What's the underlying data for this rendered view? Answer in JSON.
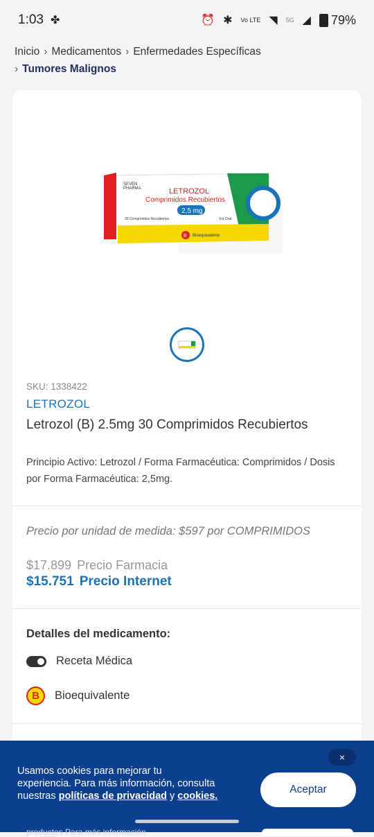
{
  "status_bar": {
    "time": "1:03",
    "battery": "79%",
    "network": "5G",
    "volte": "Vo LTE"
  },
  "breadcrumb": {
    "items": [
      "Inicio",
      "Medicamentos",
      "Enfermedades Específicas"
    ],
    "current": "Tumores Malignos"
  },
  "product": {
    "image_lettering": {
      "brand_logo": "SEVEN PHARMA",
      "name": "LETROZOL",
      "form": "Comprimidos Recubiertos",
      "dose": "2,5 mg",
      "count": "30 Comprimidos Recubiertos",
      "route": "Vía Oral",
      "badge": "Bioequivalente"
    },
    "sku": "SKU: 1338422",
    "brand": "LETROZOL",
    "title": "Letrozol (B) 2.5mg 30 Comprimidos Recubiertos",
    "description": "Principio Activo: Letrozol / Forma Farmacéutica: Comprimidos / Dosis por Forma Farmacéutica: 2,5mg."
  },
  "pricing": {
    "unit_price": "Precio por unidad de medida: $597 por COMPRIMIDOS",
    "pharmacy_price": "$17.899",
    "pharmacy_label": "Precio Farmacia",
    "internet_price": "$15.751",
    "internet_label": "Precio Internet"
  },
  "details": {
    "heading": "Detalles del medicamento:",
    "items": [
      {
        "label": "Receta Médica",
        "icon": "prescription-toggle-icon"
      },
      {
        "label": "Bioequivalente",
        "icon": "bioequivalent-b-icon",
        "badge": "B"
      }
    ]
  },
  "cookie_banner": {
    "text": "Usamos cookies para mejorar tu experiencia. Para más información, consulta nuestras ",
    "link1": "políticas de privacidad",
    "joiner": " y ",
    "link2": "cookies.",
    "accept_label": "Aceptar",
    "close_label": "×",
    "peek_text": "productos Para más información"
  },
  "colors": {
    "accent": "#1a72b8",
    "banner": "#0c3f8e"
  }
}
